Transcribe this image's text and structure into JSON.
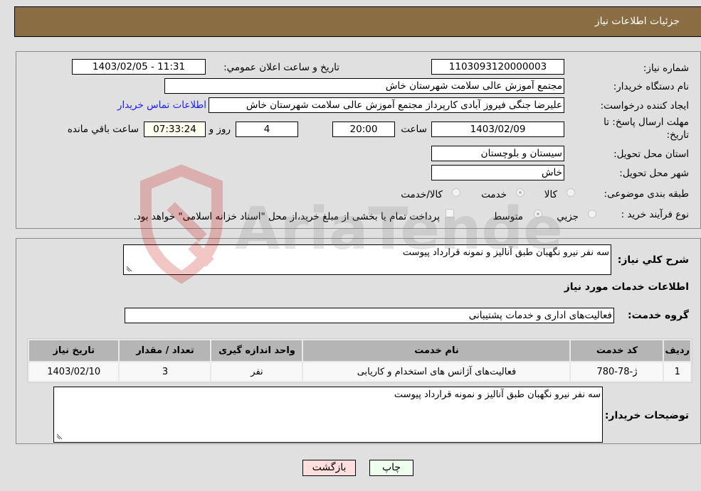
{
  "header": {
    "title": "جزئیات اطلاعات نیاز"
  },
  "fields": {
    "need_number": {
      "label": "شماره نیاز:",
      "value": "1103093120000003"
    },
    "announce_datetime": {
      "label": "تاريخ و ساعت اعلان عمومي:",
      "value": "1403/02/05 - 11:31"
    },
    "buyer_org": {
      "label": "نام دستگاه خریدار:",
      "value": "مجتمع آموزش عالی سلامت شهرستان خاش"
    },
    "creator": {
      "label": "ایجاد کننده درخواست:",
      "value": "علیرضا جنگی فیروز آبادی کارپرداز مجتمع آموزش عالی سلامت شهرستان خاش"
    },
    "buyer_contact_link": "اطلاعات تماس خریدار",
    "deadline": {
      "label_line1": "مهلت ارسال پاسخ: تا",
      "label_line2": "تاریخ:",
      "date": "1403/02/09",
      "time_label": "ساعت",
      "time": "20:00",
      "days": "4",
      "days_label": "روز و",
      "remaining": "07:33:24",
      "remaining_label": "ساعت باقي مانده"
    },
    "province": {
      "label": "استان محل تحویل:",
      "value": "سیستان و بلوچستان"
    },
    "city": {
      "label": "شهر محل تحویل:",
      "value": "خاش"
    },
    "category": {
      "label": "طبقه بندی موضوعی:",
      "options": [
        "کالا",
        "خدمت",
        "کالا/خدمت"
      ],
      "selected": "خدمت"
    },
    "purchase_type": {
      "label": "نوع فرآیند خرید :",
      "options": [
        "جزيي",
        "متوسط"
      ],
      "selected": "متوسط",
      "treasury_note": "پرداخت تمام یا بخشی از مبلغ خرید،از محل \"اسناد خزانه اسلامی\" خواهد بود."
    }
  },
  "description": {
    "label": "شرح کلي نياز:",
    "value": "سه نفر نیرو نگهبان طبق آنالیز و نمونه قرارداد پیوست"
  },
  "services_section": {
    "title": "اطلاعات خدمات مورد نیاز",
    "group_label": "گروه خدمت:",
    "group_value": "فعالیت‌های اداری و خدمات پشتیبانی",
    "table": {
      "headers": [
        "ردیف",
        "کد خدمت",
        "نام خدمت",
        "واحد اندازه گیری",
        "تعداد / مقدار",
        "تاریخ نیاز"
      ],
      "rows": [
        [
          "1",
          "ژ-78-780",
          "فعالیت‌های آژانس های استخدام و کاریابی",
          "نفر",
          "3",
          "1403/02/10"
        ]
      ]
    }
  },
  "buyer_notes": {
    "label": "توضیحات خریدار:",
    "value": "سه نفر نیرو نگهبان طبق آنالیز و نمونه قرارداد پیوست"
  },
  "buttons": {
    "back": "بازگشت",
    "print": "چاپ"
  },
  "colors": {
    "header_bg": "#8b6d43",
    "back_btn": "#ffdede",
    "print_btn": "#eeffee",
    "link": "#1a1aff"
  },
  "watermark": "AriaTender.neT"
}
